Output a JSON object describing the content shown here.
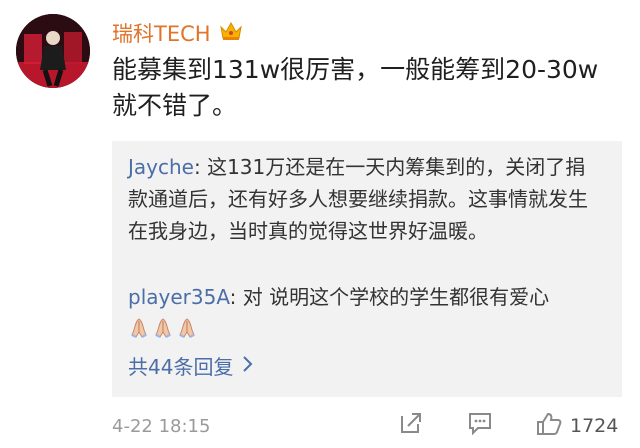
{
  "comment": {
    "username": "瑞科TECH",
    "text": "能募集到131w很厉害，一般能筹到20-30w就不错了。",
    "time": "4-22 18:15",
    "like_count": "1724",
    "icons": {
      "crown": "crown-badge-icon",
      "share": "share-icon",
      "reply": "comment-icon",
      "like": "thumbs-up-icon"
    }
  },
  "replies": [
    {
      "author": "Jayche",
      "text": ": 这131万还是在一天内筹集到的，关闭了捐款通道后，还有好多人想要继续捐款。这事情就发生在我身边，当时真的觉得这世界好温暖。"
    },
    {
      "author": "player35A",
      "text": ": 对 说明这个学校的学生都很有爱心"
    }
  ],
  "more_replies_label": "共44条回复",
  "colors": {
    "username": "#e0742a",
    "link": "#4b6ea8",
    "reply_bg": "#f2f2f2",
    "meta": "#9a9a9a"
  }
}
